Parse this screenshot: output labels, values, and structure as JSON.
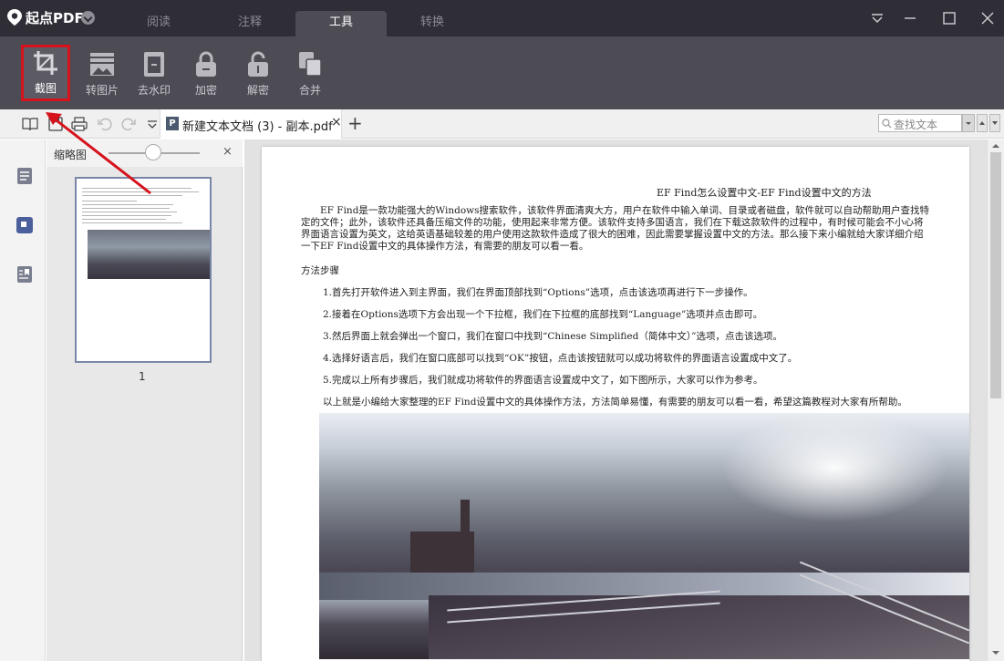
{
  "app": {
    "name": "起点PDF"
  },
  "tabs": [
    {
      "label": "阅读",
      "active": false
    },
    {
      "label": "注释",
      "active": false
    },
    {
      "label": "工具",
      "active": true
    },
    {
      "label": "转换",
      "active": false
    }
  ],
  "toolbar": {
    "tools": [
      {
        "label": "截图",
        "icon": "crop-icon",
        "selected": true
      },
      {
        "label": "转图片",
        "icon": "image-convert-icon",
        "selected": false
      },
      {
        "label": "去水印",
        "icon": "watermark-remove-icon",
        "selected": false
      },
      {
        "label": "加密",
        "icon": "lock-icon",
        "selected": false
      },
      {
        "label": "解密",
        "icon": "unlock-icon",
        "selected": false
      },
      {
        "label": "合并",
        "icon": "merge-icon",
        "selected": false
      }
    ]
  },
  "document_tab": {
    "badge": "P",
    "name": "新建文本文档 (3) - 副本.pdf",
    "close": "×",
    "new_tab": "+"
  },
  "search": {
    "label": "查找文本"
  },
  "thumbnail_panel": {
    "title": "缩略图",
    "close": "×",
    "page_number": "1"
  },
  "page": {
    "title": "EF Find怎么设置中文-EF Find设置中文的方法",
    "intro": "EF Find是一款功能强大的Windows搜索软件，该软件界面清爽大方，用户在软件中输入单词、目录或者磁盘，软件就可以自动帮助用户查找特定的文件；此外，该软件还具备压缩文件的功能，使用起来非常方便。该软件支持多国语言，我们在下载这款软件的过程中，有时候可能会不小心将界面语言设置为英文，这给英语基础较差的用户使用这款软件造成了很大的困难，因此需要掌握设置中文的方法。那么接下来小编就给大家详细介绍一下EF Find设置中文的具体操作方法，有需要的朋友可以看一看。",
    "section": "方法步骤",
    "steps": [
      "1.首先打开软件进入到主界面，我们在界面顶部找到“Options”选项，点击该选项再进行下一步操作。",
      "2.接着在Options选项下方会出现一个下拉框，我们在下拉框的底部找到“Language”选项并点击即可。",
      "3.然后界面上就会弹出一个窗口，我们在窗口中找到“Chinese Simplified（简体中文）”选项，点击该选项。",
      "4.选择好语言后，我们在窗口底部可以找到“OK”按钮，点击该按钮就可以成功将软件的界面语言设置成中文了。",
      "5.完成以上所有步骤后，我们就成功将软件的界面语言设置成中文了，如下图所示，大家可以作为参考。"
    ],
    "summary": "以上就是小编给大家整理的EF Find设置中文的具体操作方法，方法简单易懂，有需要的朋友可以看一看，希望这篇教程对大家有所帮助。"
  },
  "colors": {
    "titlebar": "#2f2e36",
    "toolbar": "#4d4c55",
    "highlight": "#d6121c",
    "annotation_arrow": "#d6121c"
  }
}
